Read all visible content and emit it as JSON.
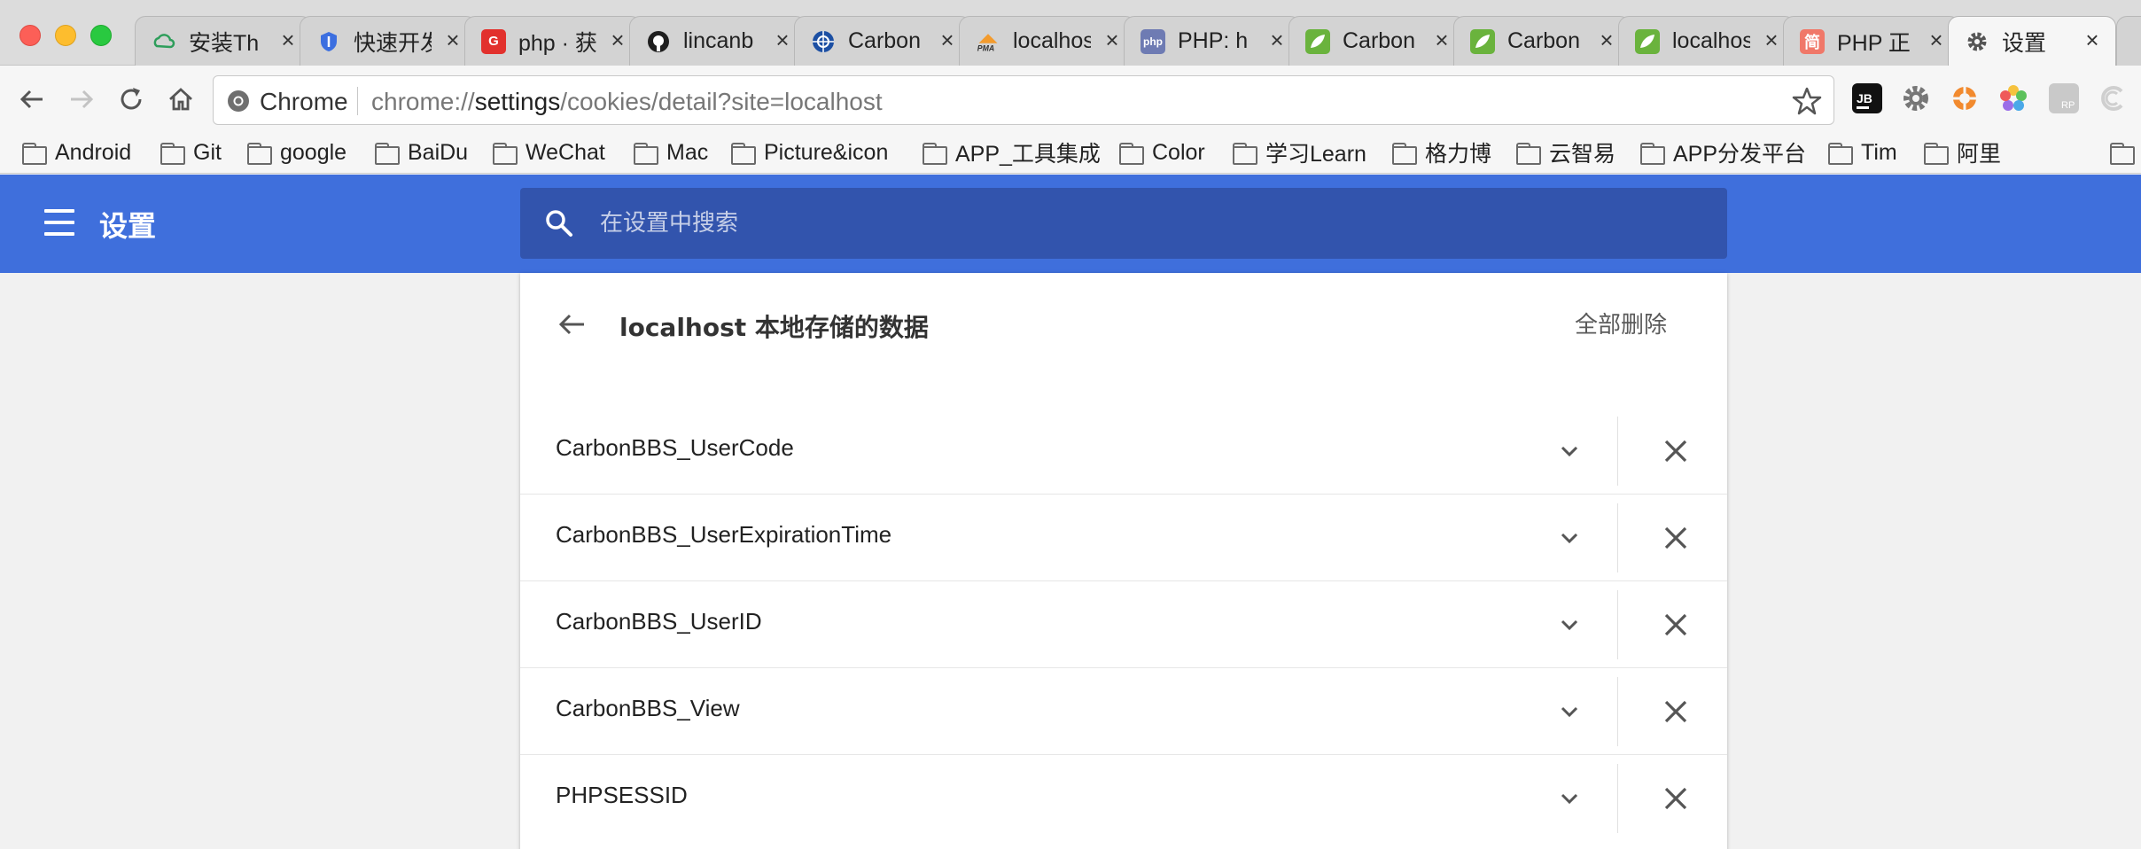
{
  "tabs": [
    {
      "title": "安装Th",
      "icon": "cloud-icon",
      "color": "#2e9e5b"
    },
    {
      "title": "快速开发",
      "icon": "shield-icon",
      "color": "#3c6fe0"
    },
    {
      "title": "php · 获",
      "icon": "g-logo-icon",
      "color": "#e2312d"
    },
    {
      "title": "lincanb",
      "icon": "github-icon",
      "color": "#1f1f1f"
    },
    {
      "title": "Carbon",
      "icon": "globe-icon",
      "color": "#1c4fa3"
    },
    {
      "title": "localhost",
      "icon": "pma-icon",
      "color": "#f39b2d"
    },
    {
      "title": "PHP: h",
      "icon": "php-icon",
      "color": "#6e7bb3"
    },
    {
      "title": "Carbon",
      "icon": "leaf-icon",
      "color": "#6ab33d"
    },
    {
      "title": "Carbon",
      "icon": "leaf-icon",
      "color": "#6ab33d"
    },
    {
      "title": "localhost",
      "icon": "leaf-icon",
      "color": "#6ab33d"
    },
    {
      "title": "PHP 正",
      "icon": "jian-icon",
      "color": "#f07869"
    },
    {
      "title": "设置",
      "icon": "gear-icon",
      "color": "#555555"
    }
  ],
  "toolbar": {
    "omnibox_label": "Chrome",
    "url_prefix": "chrome://",
    "url_host": "settings",
    "url_path": "/cookies/detail?site=localhost"
  },
  "bookmarks": [
    "Android",
    "Git",
    "google",
    "BaiDu",
    "WeChat",
    "Mac",
    "Picture&icon",
    "APP_工具集成",
    "Color",
    "学习Learn",
    "格力博",
    "云智易",
    "APP分发平台",
    "Tim",
    "阿里"
  ],
  "settings": {
    "title": "设置",
    "search_placeholder": "在设置中搜索",
    "accent": "#3f6fdc"
  },
  "detail": {
    "title": "localhost 本地存储的数据",
    "remove_all_label": "全部删除",
    "items": [
      "CarbonBBS_UserCode",
      "CarbonBBS_UserExpirationTime",
      "CarbonBBS_UserID",
      "CarbonBBS_View",
      "PHPSESSID"
    ]
  }
}
